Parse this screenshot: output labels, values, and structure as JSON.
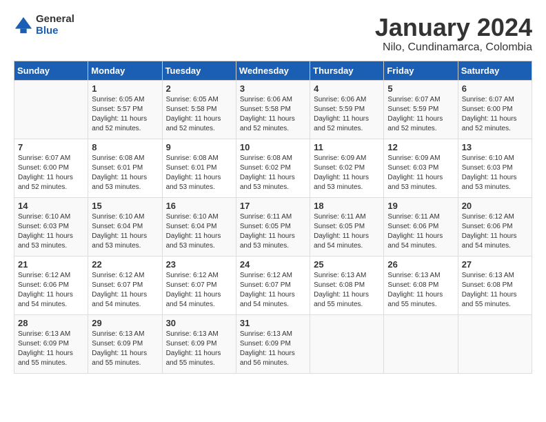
{
  "logo": {
    "general": "General",
    "blue": "Blue"
  },
  "title": "January 2024",
  "location": "Nilo, Cundinamarca, Colombia",
  "days_header": [
    "Sunday",
    "Monday",
    "Tuesday",
    "Wednesday",
    "Thursday",
    "Friday",
    "Saturday"
  ],
  "weeks": [
    [
      {
        "day": "",
        "info": ""
      },
      {
        "day": "1",
        "info": "Sunrise: 6:05 AM\nSunset: 5:57 PM\nDaylight: 11 hours\nand 52 minutes."
      },
      {
        "day": "2",
        "info": "Sunrise: 6:05 AM\nSunset: 5:58 PM\nDaylight: 11 hours\nand 52 minutes."
      },
      {
        "day": "3",
        "info": "Sunrise: 6:06 AM\nSunset: 5:58 PM\nDaylight: 11 hours\nand 52 minutes."
      },
      {
        "day": "4",
        "info": "Sunrise: 6:06 AM\nSunset: 5:59 PM\nDaylight: 11 hours\nand 52 minutes."
      },
      {
        "day": "5",
        "info": "Sunrise: 6:07 AM\nSunset: 5:59 PM\nDaylight: 11 hours\nand 52 minutes."
      },
      {
        "day": "6",
        "info": "Sunrise: 6:07 AM\nSunset: 6:00 PM\nDaylight: 11 hours\nand 52 minutes."
      }
    ],
    [
      {
        "day": "7",
        "info": "Sunrise: 6:07 AM\nSunset: 6:00 PM\nDaylight: 11 hours\nand 52 minutes."
      },
      {
        "day": "8",
        "info": "Sunrise: 6:08 AM\nSunset: 6:01 PM\nDaylight: 11 hours\nand 53 minutes."
      },
      {
        "day": "9",
        "info": "Sunrise: 6:08 AM\nSunset: 6:01 PM\nDaylight: 11 hours\nand 53 minutes."
      },
      {
        "day": "10",
        "info": "Sunrise: 6:08 AM\nSunset: 6:02 PM\nDaylight: 11 hours\nand 53 minutes."
      },
      {
        "day": "11",
        "info": "Sunrise: 6:09 AM\nSunset: 6:02 PM\nDaylight: 11 hours\nand 53 minutes."
      },
      {
        "day": "12",
        "info": "Sunrise: 6:09 AM\nSunset: 6:03 PM\nDaylight: 11 hours\nand 53 minutes."
      },
      {
        "day": "13",
        "info": "Sunrise: 6:10 AM\nSunset: 6:03 PM\nDaylight: 11 hours\nand 53 minutes."
      }
    ],
    [
      {
        "day": "14",
        "info": "Sunrise: 6:10 AM\nSunset: 6:03 PM\nDaylight: 11 hours\nand 53 minutes."
      },
      {
        "day": "15",
        "info": "Sunrise: 6:10 AM\nSunset: 6:04 PM\nDaylight: 11 hours\nand 53 minutes."
      },
      {
        "day": "16",
        "info": "Sunrise: 6:10 AM\nSunset: 6:04 PM\nDaylight: 11 hours\nand 53 minutes."
      },
      {
        "day": "17",
        "info": "Sunrise: 6:11 AM\nSunset: 6:05 PM\nDaylight: 11 hours\nand 53 minutes."
      },
      {
        "day": "18",
        "info": "Sunrise: 6:11 AM\nSunset: 6:05 PM\nDaylight: 11 hours\nand 54 minutes."
      },
      {
        "day": "19",
        "info": "Sunrise: 6:11 AM\nSunset: 6:06 PM\nDaylight: 11 hours\nand 54 minutes."
      },
      {
        "day": "20",
        "info": "Sunrise: 6:12 AM\nSunset: 6:06 PM\nDaylight: 11 hours\nand 54 minutes."
      }
    ],
    [
      {
        "day": "21",
        "info": "Sunrise: 6:12 AM\nSunset: 6:06 PM\nDaylight: 11 hours\nand 54 minutes."
      },
      {
        "day": "22",
        "info": "Sunrise: 6:12 AM\nSunset: 6:07 PM\nDaylight: 11 hours\nand 54 minutes."
      },
      {
        "day": "23",
        "info": "Sunrise: 6:12 AM\nSunset: 6:07 PM\nDaylight: 11 hours\nand 54 minutes."
      },
      {
        "day": "24",
        "info": "Sunrise: 6:12 AM\nSunset: 6:07 PM\nDaylight: 11 hours\nand 54 minutes."
      },
      {
        "day": "25",
        "info": "Sunrise: 6:13 AM\nSunset: 6:08 PM\nDaylight: 11 hours\nand 55 minutes."
      },
      {
        "day": "26",
        "info": "Sunrise: 6:13 AM\nSunset: 6:08 PM\nDaylight: 11 hours\nand 55 minutes."
      },
      {
        "day": "27",
        "info": "Sunrise: 6:13 AM\nSunset: 6:08 PM\nDaylight: 11 hours\nand 55 minutes."
      }
    ],
    [
      {
        "day": "28",
        "info": "Sunrise: 6:13 AM\nSunset: 6:09 PM\nDaylight: 11 hours\nand 55 minutes."
      },
      {
        "day": "29",
        "info": "Sunrise: 6:13 AM\nSunset: 6:09 PM\nDaylight: 11 hours\nand 55 minutes."
      },
      {
        "day": "30",
        "info": "Sunrise: 6:13 AM\nSunset: 6:09 PM\nDaylight: 11 hours\nand 55 minutes."
      },
      {
        "day": "31",
        "info": "Sunrise: 6:13 AM\nSunset: 6:09 PM\nDaylight: 11 hours\nand 56 minutes."
      },
      {
        "day": "",
        "info": ""
      },
      {
        "day": "",
        "info": ""
      },
      {
        "day": "",
        "info": ""
      }
    ]
  ]
}
